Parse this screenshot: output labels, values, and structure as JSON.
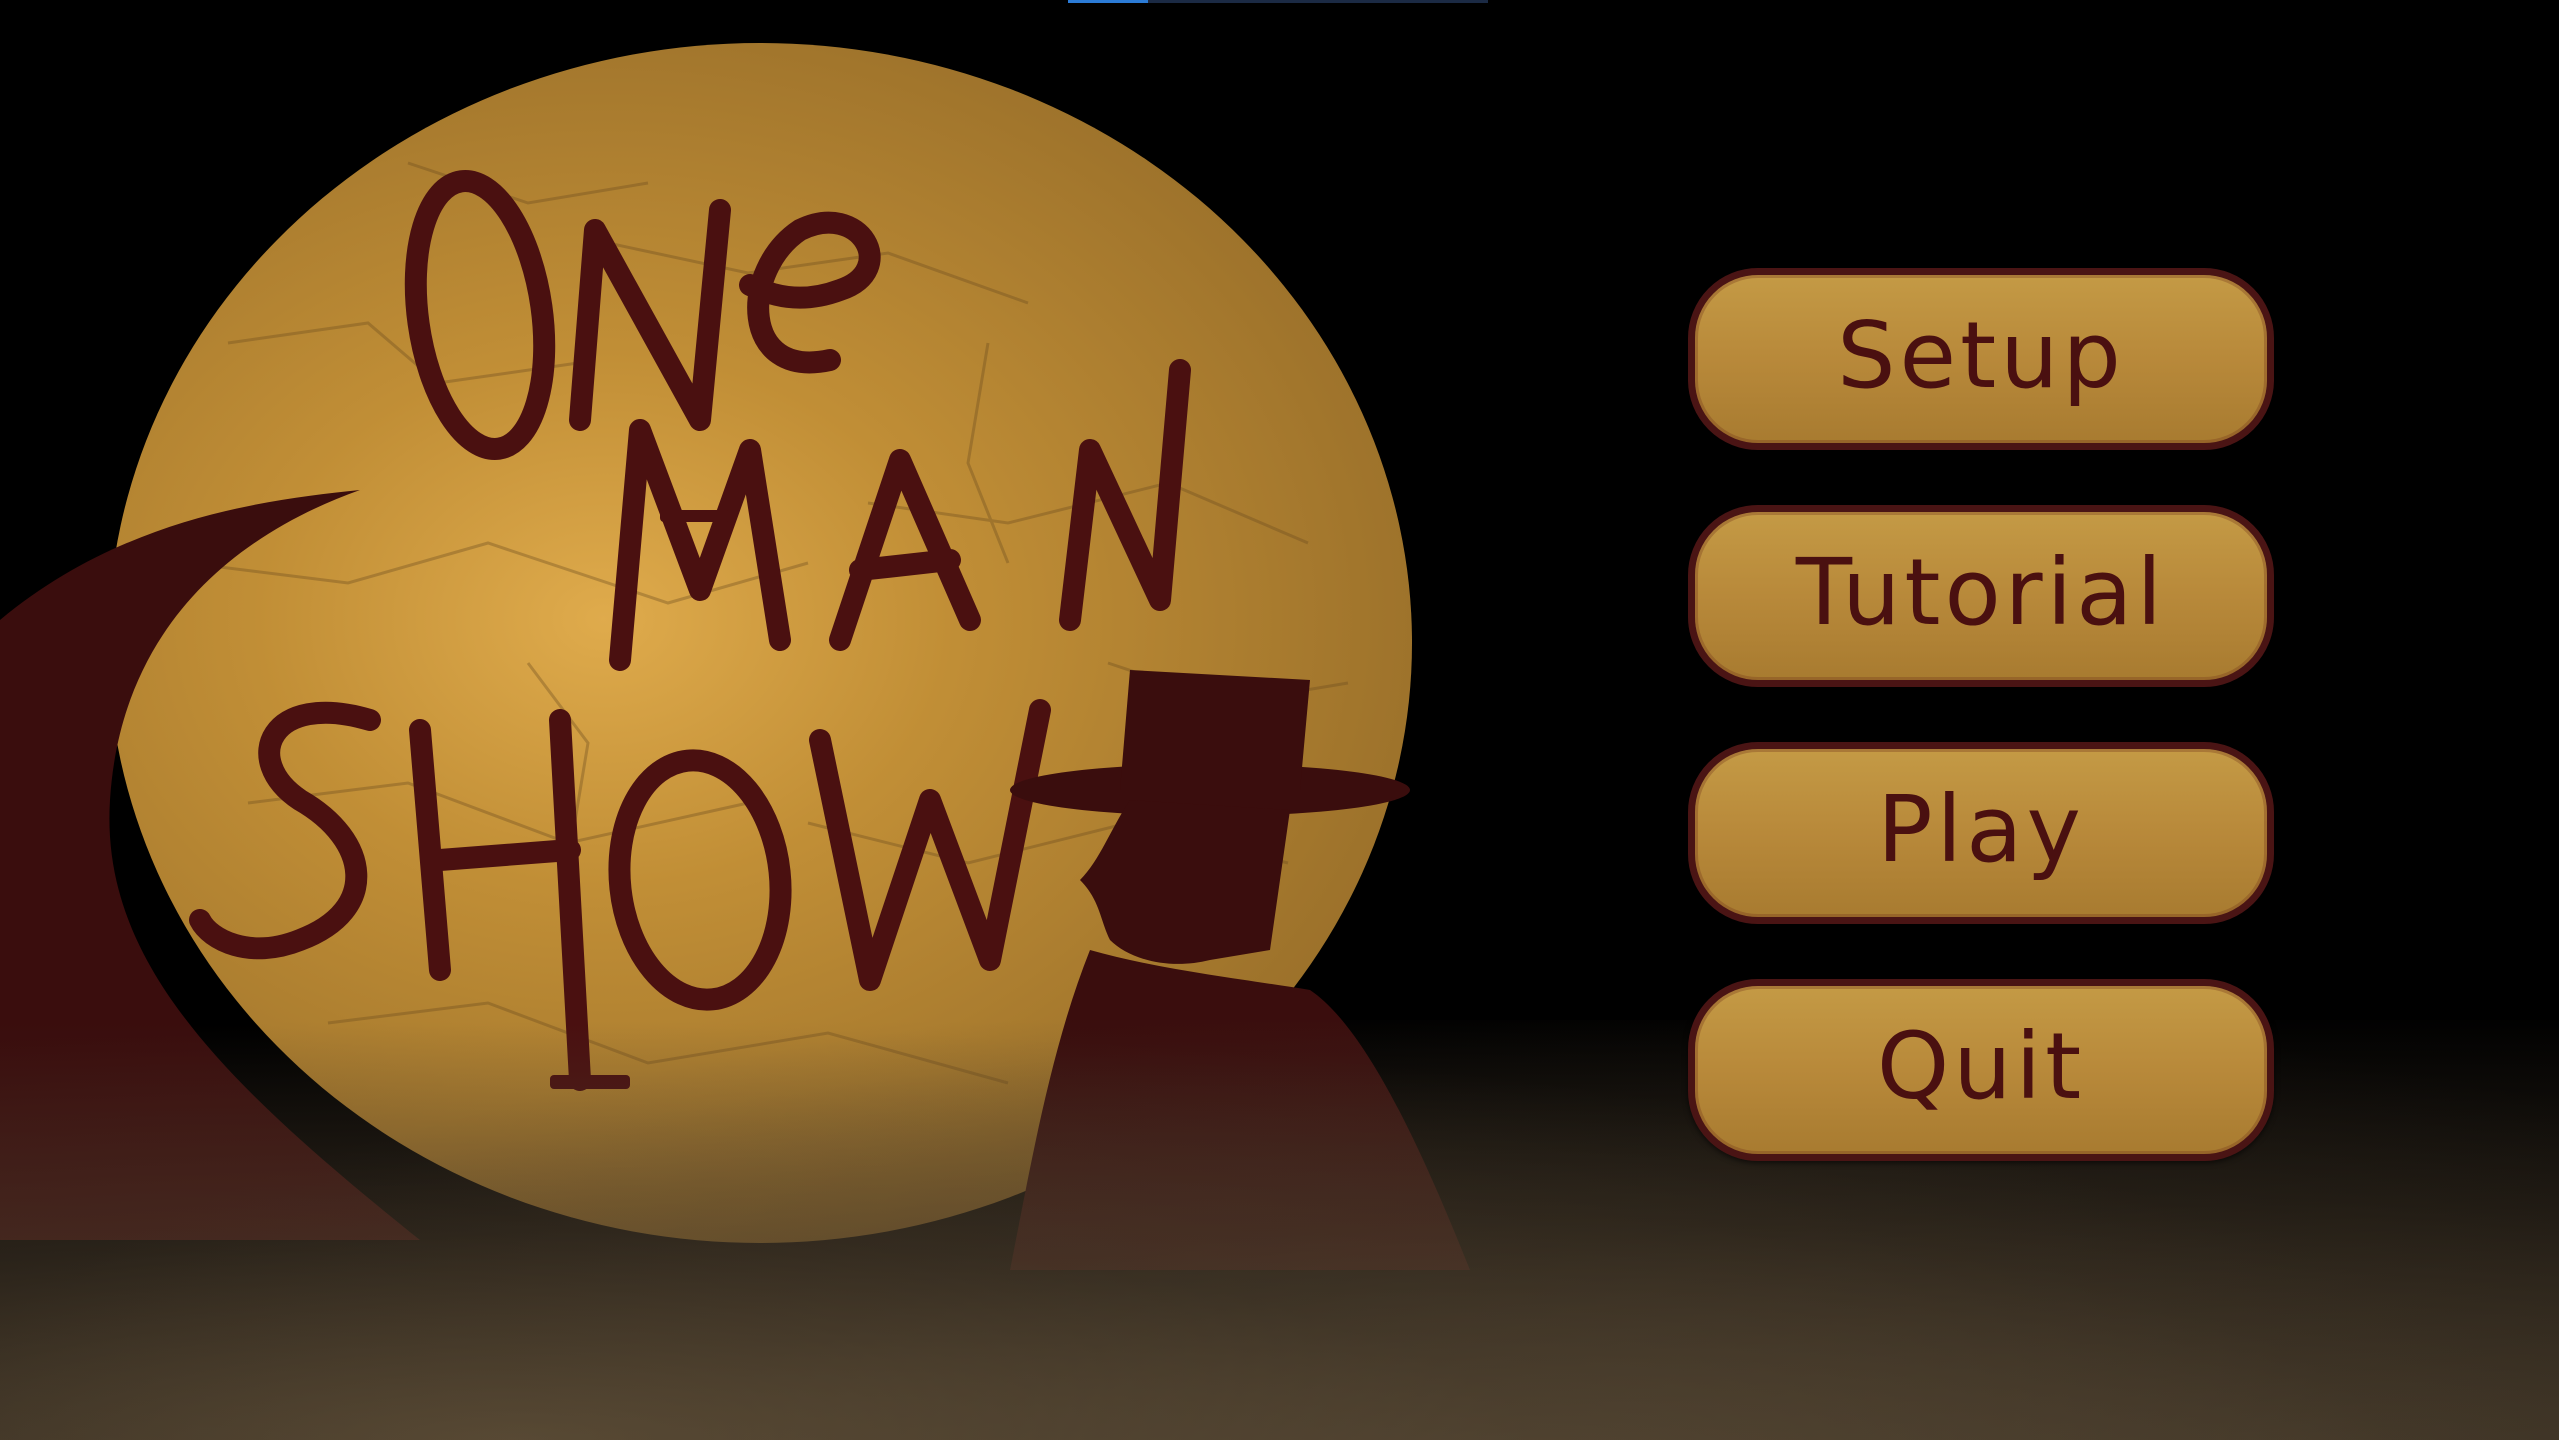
{
  "title": {
    "line1": "ONE",
    "line2": "MAN",
    "line3": "SHOW"
  },
  "menu": {
    "items": [
      {
        "label": "Setup"
      },
      {
        "label": "Tutorial"
      },
      {
        "label": "Play"
      },
      {
        "label": "Quit"
      }
    ]
  },
  "colors": {
    "background": "#000000",
    "moon": "#d49a42",
    "title_ink": "#4a1010",
    "button_fill": "#b8893a",
    "button_border": "#4a1414"
  }
}
